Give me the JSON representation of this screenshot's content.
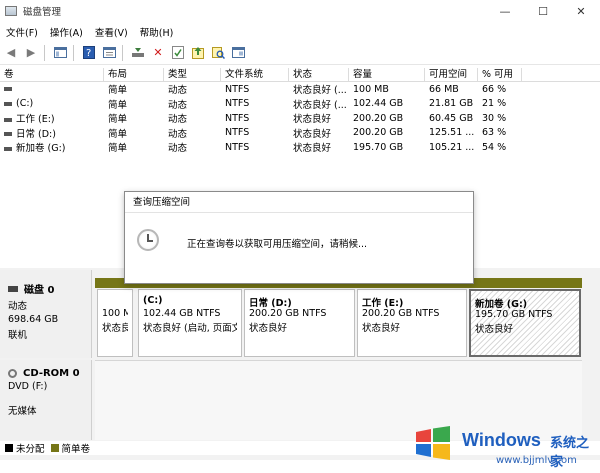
{
  "window": {
    "title": "磁盘管理"
  },
  "menu": [
    "文件(F)",
    "操作(A)",
    "查看(V)",
    "帮助(H)"
  ],
  "table": {
    "headers": [
      "卷",
      "布局",
      "类型",
      "文件系统",
      "状态",
      "容量",
      "可用空间",
      "% 可用"
    ],
    "rows": [
      [
        "",
        "简单",
        "动态",
        "NTFS",
        "状态良好 (...",
        "100 MB",
        "66 MB",
        "66 %"
      ],
      [
        "(C:)",
        "简单",
        "动态",
        "NTFS",
        "状态良好 (...",
        "102.44 GB",
        "21.81 GB",
        "21 %"
      ],
      [
        "工作 (E:)",
        "简单",
        "动态",
        "NTFS",
        "状态良好",
        "200.20 GB",
        "60.45 GB",
        "30 %"
      ],
      [
        "日常 (D:)",
        "简单",
        "动态",
        "NTFS",
        "状态良好",
        "200.20 GB",
        "125.51 ...",
        "63 %"
      ],
      [
        "新加卷 (G:)",
        "简单",
        "动态",
        "NTFS",
        "状态良好",
        "195.70 GB",
        "105.21 ...",
        "54 %"
      ]
    ]
  },
  "dialog": {
    "title": "查询压缩空间",
    "message": "正在查询卷以获取可用压缩空间，请稍候..."
  },
  "disk0": {
    "name": "磁盘 0",
    "type": "动态",
    "size": "698.64 GB",
    "status": "联机",
    "partitions": [
      {
        "name": "",
        "size": "100 M",
        "status": "状态良"
      },
      {
        "name": "(C:)",
        "size": "102.44 GB NTFS",
        "status": "状态良好 (启动, 页面文"
      },
      {
        "name": "日常  (D:)",
        "size": "200.20 GB NTFS",
        "status": "状态良好"
      },
      {
        "name": "工作  (E:)",
        "size": "200.20 GB NTFS",
        "status": "状态良好"
      },
      {
        "name": "新加卷  (G:)",
        "size": "195.70 GB NTFS",
        "status": "状态良好"
      }
    ]
  },
  "cdrom": {
    "name": "CD-ROM 0",
    "drive": "DVD (F:)",
    "status": "无媒体"
  },
  "legend": [
    {
      "label": "未分配",
      "color": "#000000"
    },
    {
      "label": "简单卷",
      "color": "#767617"
    }
  ],
  "watermark": {
    "brand": "Windows",
    "name": "系统之家",
    "url": "www.bjjmlv.com"
  }
}
